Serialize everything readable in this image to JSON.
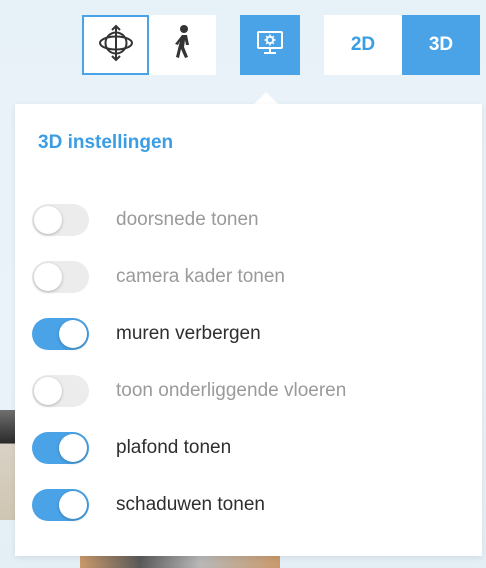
{
  "toolbar": {
    "orbit": {
      "icon": "orbit-icon",
      "active": true
    },
    "walk": {
      "icon": "walk-icon",
      "active": false
    },
    "settings": {
      "icon": "settings-monitor-icon",
      "active": true
    },
    "view_2d_label": "2D",
    "view_3d_label": "3D",
    "active_view": "3D"
  },
  "panel": {
    "title": "3D instellingen",
    "options": [
      {
        "label": "doorsnede tonen",
        "enabled": false
      },
      {
        "label": "camera kader tonen",
        "enabled": false
      },
      {
        "label": "muren verbergen",
        "enabled": true
      },
      {
        "label": "toon onderliggende vloeren",
        "enabled": false
      },
      {
        "label": "plafond tonen",
        "enabled": true
      },
      {
        "label": "schaduwen tonen",
        "enabled": true
      }
    ]
  },
  "colors": {
    "accent": "#4aa3e6",
    "toggle_off": "#ececec",
    "text_on": "#2e2e2e",
    "text_off": "#9a9a9a"
  }
}
